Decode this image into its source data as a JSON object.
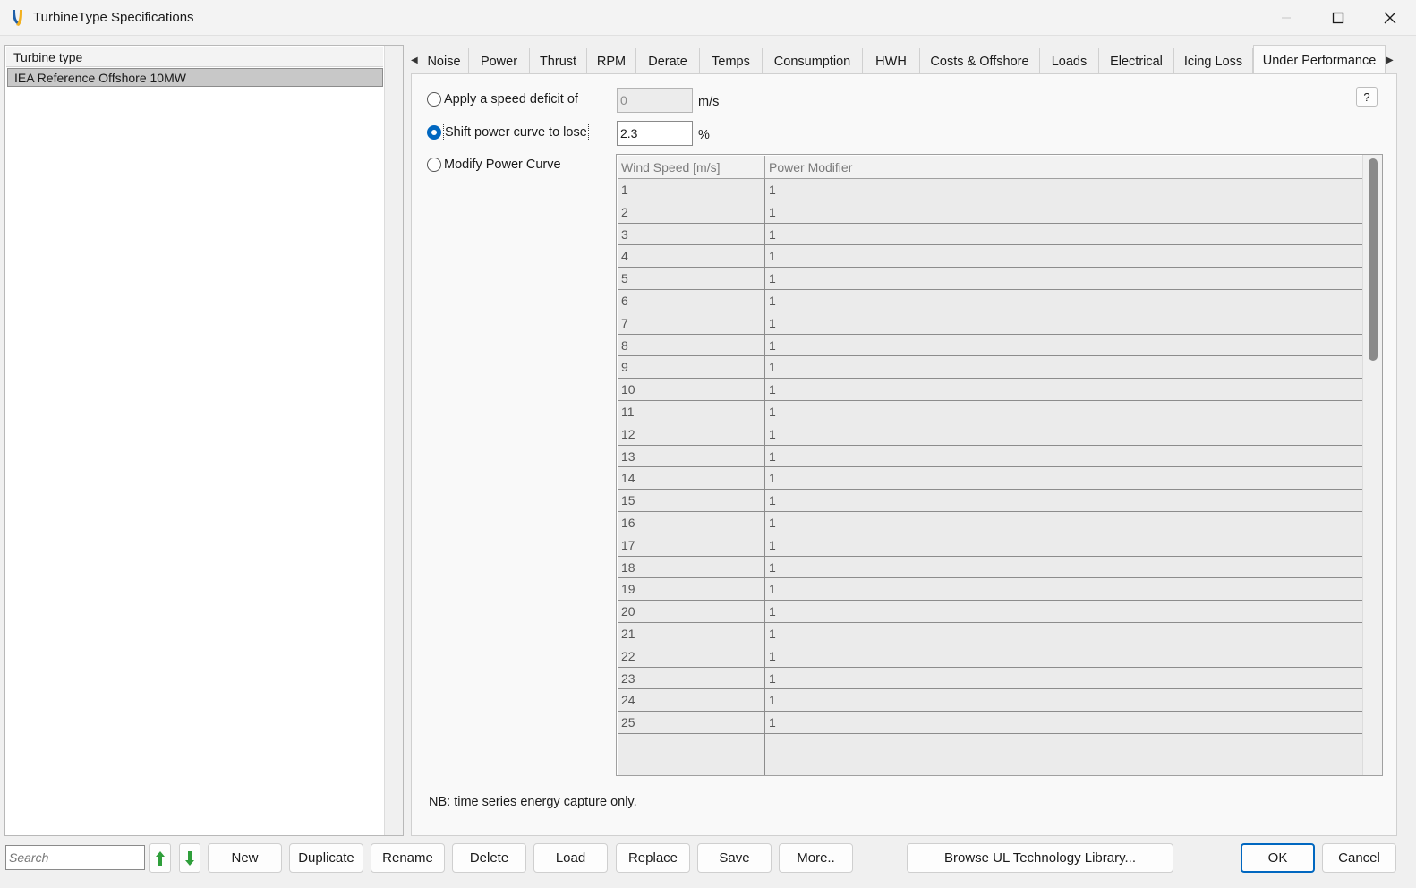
{
  "window": {
    "title": "TurbineType Specifications"
  },
  "turbine_list": {
    "header": "Turbine type",
    "items": [
      "IEA Reference Offshore 10MW"
    ],
    "selected_index": 0
  },
  "tabs": {
    "items": [
      "Noise",
      "Power",
      "Thrust",
      "RPM",
      "Derate",
      "Temps",
      "Consumption",
      "HWH",
      "Costs & Offshore",
      "Loads",
      "Electrical",
      "Icing Loss",
      "Under Performance"
    ],
    "active": "Under Performance"
  },
  "under_performance": {
    "help_label": "?",
    "option_speed_deficit": {
      "label": "Apply a speed deficit of",
      "value": "0",
      "unit": "m/s",
      "checked": false,
      "enabled": false
    },
    "option_shift_curve": {
      "label": "Shift power curve to lose",
      "value": "2.3",
      "unit": "%",
      "checked": true,
      "enabled": true
    },
    "option_modify_curve": {
      "label": "Modify Power Curve",
      "checked": false
    },
    "table": {
      "columns": [
        "Wind Speed [m/s]",
        "Power Modifier"
      ],
      "rows": [
        [
          "1",
          "1"
        ],
        [
          "2",
          "1"
        ],
        [
          "3",
          "1"
        ],
        [
          "4",
          "1"
        ],
        [
          "5",
          "1"
        ],
        [
          "6",
          "1"
        ],
        [
          "7",
          "1"
        ],
        [
          "8",
          "1"
        ],
        [
          "9",
          "1"
        ],
        [
          "10",
          "1"
        ],
        [
          "11",
          "1"
        ],
        [
          "12",
          "1"
        ],
        [
          "13",
          "1"
        ],
        [
          "14",
          "1"
        ],
        [
          "15",
          "1"
        ],
        [
          "16",
          "1"
        ],
        [
          "17",
          "1"
        ],
        [
          "18",
          "1"
        ],
        [
          "19",
          "1"
        ],
        [
          "20",
          "1"
        ],
        [
          "21",
          "1"
        ],
        [
          "22",
          "1"
        ],
        [
          "23",
          "1"
        ],
        [
          "24",
          "1"
        ],
        [
          "25",
          "1"
        ],
        [
          "",
          ""
        ],
        [
          "",
          ""
        ]
      ]
    },
    "note": "NB: time series energy capture only."
  },
  "bottom_bar": {
    "search_placeholder": "Search",
    "buttons": {
      "new": "New",
      "duplicate": "Duplicate",
      "rename": "Rename",
      "delete": "Delete",
      "load": "Load",
      "replace": "Replace",
      "save": "Save",
      "more": "More..",
      "browse": "Browse UL Technology Library...",
      "ok": "OK",
      "cancel": "Cancel"
    }
  },
  "colors": {
    "accent": "#0067c0",
    "arrow_green": "#2e9e3a"
  }
}
